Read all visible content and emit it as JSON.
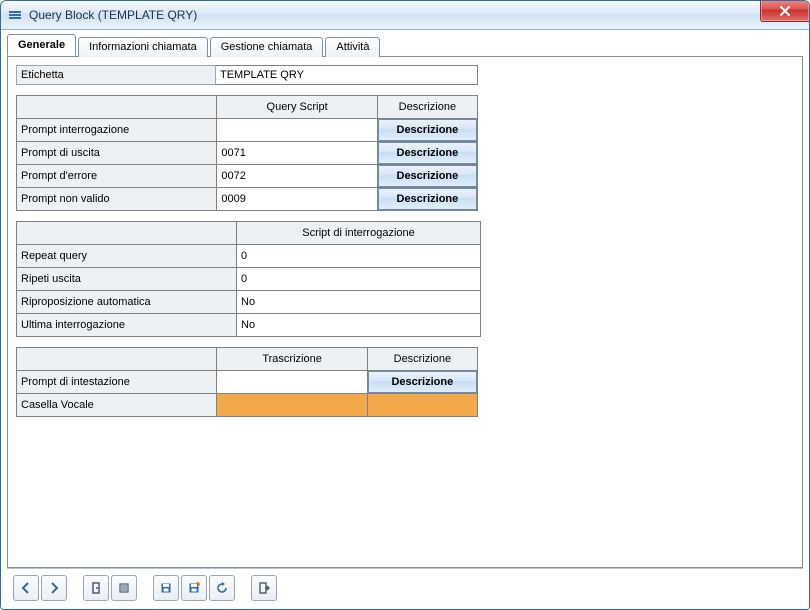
{
  "window": {
    "title": "Query Block (TEMPLATE QRY)"
  },
  "tabs": {
    "generale": "Generale",
    "info": "Informazioni chiamata",
    "gestione": "Gestione chiamata",
    "attivita": "Attività"
  },
  "etichetta": {
    "label": "Etichetta",
    "value": "TEMPLATE QRY"
  },
  "table1": {
    "head_script": "Query Script",
    "head_descr": "Descrizione",
    "rows": [
      {
        "label": "Prompt interrogazione",
        "value": ""
      },
      {
        "label": "Prompt di uscita",
        "value": "0071"
      },
      {
        "label": "Prompt d'errore",
        "value": "0072"
      },
      {
        "label": "Prompt non valido",
        "value": "0009"
      }
    ],
    "btn_label": "Descrizione"
  },
  "table2": {
    "header": "Script di interrogazione",
    "rows": [
      {
        "label": "Repeat query",
        "value": "0"
      },
      {
        "label": "Ripeti uscita",
        "value": "0"
      },
      {
        "label": "Riproposizione automatica",
        "value": "No"
      },
      {
        "label": "Ultima interrogazione",
        "value": "No"
      }
    ]
  },
  "table3": {
    "head_trascr": "Trascrizione",
    "head_descr": "Descrizione",
    "rows": [
      {
        "label": "Prompt di intestazione",
        "value": ""
      },
      {
        "label": "Casella Vocale",
        "value": ""
      }
    ],
    "btn_label": "Descrizione"
  }
}
